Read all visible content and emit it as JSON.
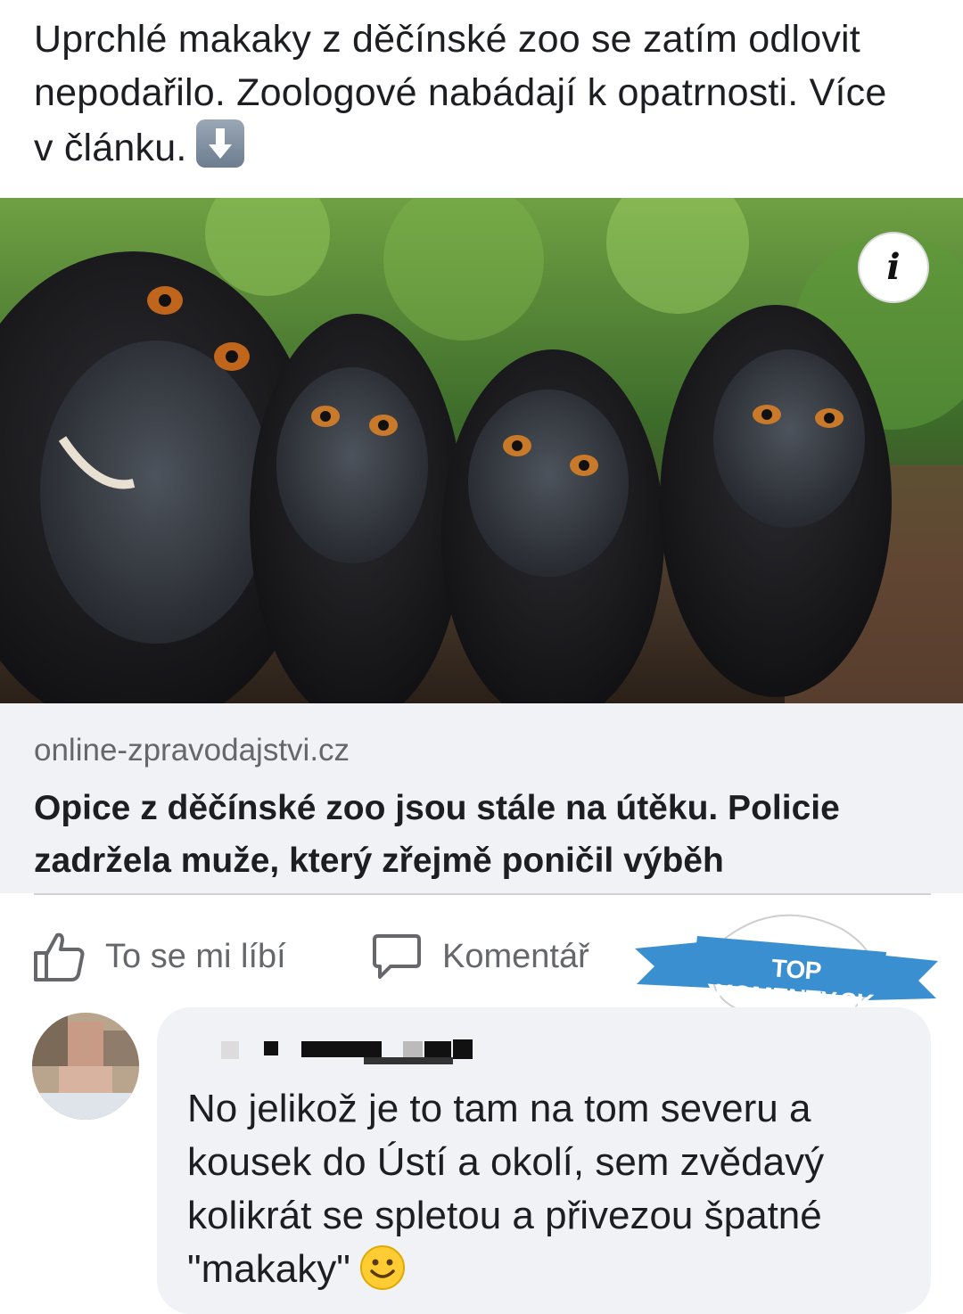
{
  "post": {
    "text": "Uprchlé makaky z děčínské zoo se zatím odlovit nepodařilo. Zoologové nabádají k opatrnosti. Více v článku.",
    "emoji_icon": "down-arrow-emoji"
  },
  "link_card": {
    "domain": "online-zpravodajstvi.cz",
    "title": "Opice z děčínské zoo jsou stále na útěku. Policie zadržela muže, který zřejmě poničil výběh",
    "info_label": "i"
  },
  "actions": {
    "like_label": "To se mi líbí",
    "comment_label": "Komentář"
  },
  "watermark": {
    "text": "TOP KOMENTY.SK",
    "color": "#3a8fd0"
  },
  "comment": {
    "author": "",
    "text": "No jelikož je to tam na tom severu a kousek do Ústí a okolí, sem zvědavý kolikrát se spletou a přivezou špatné \"makaky\""
  },
  "colors": {
    "text": "#1c1e21",
    "secondary": "#65676b",
    "card_bg": "#f0f2f5"
  }
}
